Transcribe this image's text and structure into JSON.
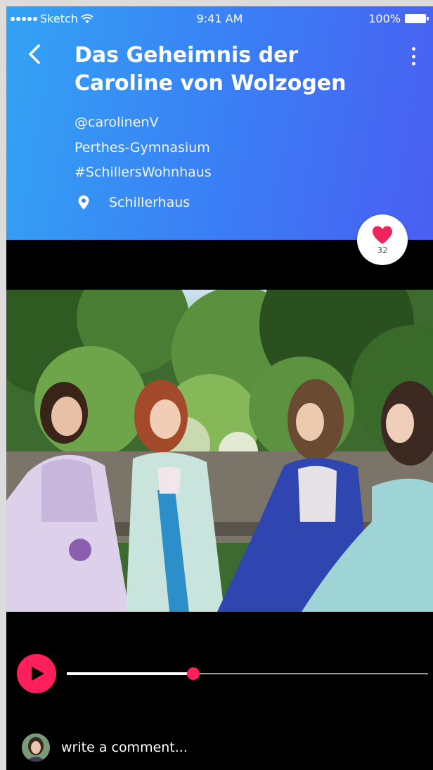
{
  "status_bar": {
    "carrier": "Sketch",
    "time": "9:41 AM",
    "battery": "100%"
  },
  "header": {
    "title_line1": "Das Geheimnis der",
    "title_line2": "Caroline von Wolzogen",
    "user_handle": "@carolinenV",
    "school": "Perthes-Gymnasium",
    "hashtag": "#SchillersWohnhaus",
    "location": "Schillerhaus"
  },
  "like": {
    "count": "32"
  },
  "player": {
    "progress_fraction": 0.35
  },
  "comment": {
    "placeholder": "write a comment..."
  },
  "colors": {
    "accent": "#ff1f5a",
    "header_gradient_start": "#33a3f4",
    "header_gradient_end": "#4a5ff2",
    "background": "#000000"
  },
  "icons": {
    "back": "chevron-left-icon",
    "menu": "more-vertical-icon",
    "location": "map-pin-icon",
    "like": "heart-icon",
    "play": "play-icon",
    "wifi": "wifi-icon",
    "battery": "battery-icon"
  }
}
